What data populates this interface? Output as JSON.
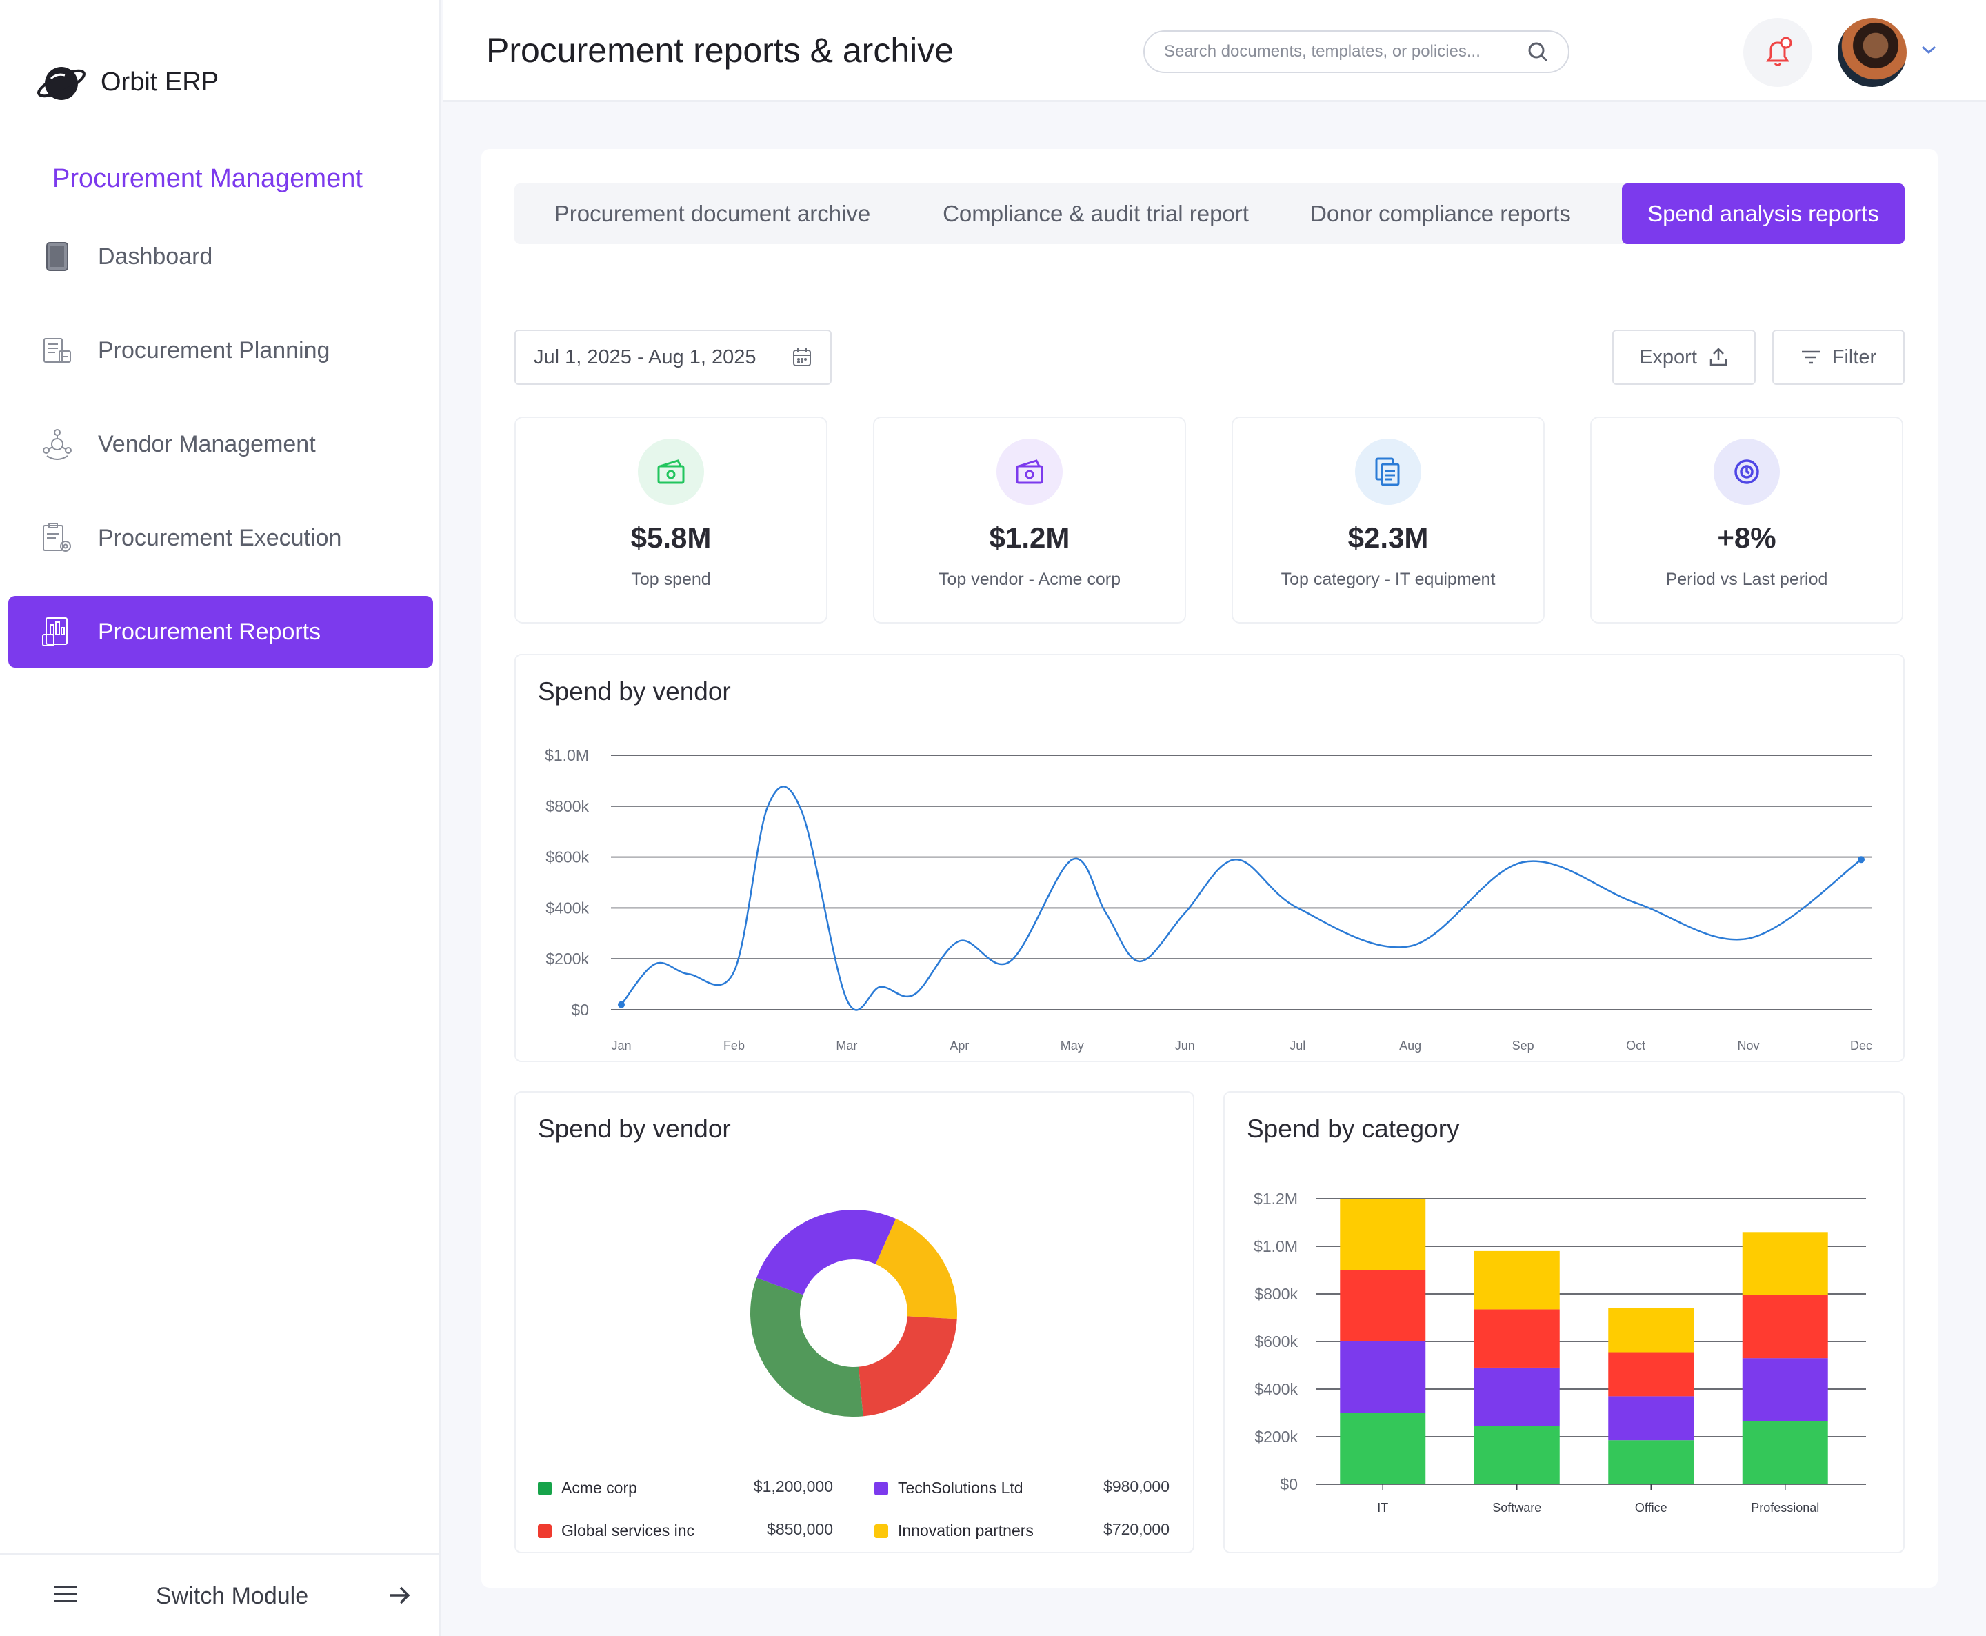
{
  "app": {
    "name": "Orbit ERP"
  },
  "sidebar": {
    "module_title": "Procurement Management",
    "items": [
      {
        "label": "Dashboard",
        "icon": "tablet-icon"
      },
      {
        "label": "Procurement Planning",
        "icon": "planning-clipboard-icon"
      },
      {
        "label": "Vendor Management",
        "icon": "vendor-network-icon"
      },
      {
        "label": "Procurement Execution",
        "icon": "execution-gear-icon"
      },
      {
        "label": "Procurement Reports",
        "icon": "report-chart-icon",
        "active": true
      }
    ],
    "footer": {
      "label": "Switch Module"
    }
  },
  "header": {
    "title": "Procurement reports & archive",
    "search_placeholder": "Search documents, templates, or policies..."
  },
  "tabs": [
    {
      "label": "Procurement document archive"
    },
    {
      "label": "Compliance & audit trial report"
    },
    {
      "label": "Donor compliance reports"
    },
    {
      "label": "Spend analysis reports",
      "active": true
    }
  ],
  "toolbar": {
    "date_range": "Jul 1, 2025 - Aug 1, 2025",
    "export_label": "Export",
    "filter_label": "Filter"
  },
  "stats": [
    {
      "value": "$5.8M",
      "label": "Top spend",
      "color": "#22c55e",
      "bg": "#e6f7ec",
      "icon": "money-icon"
    },
    {
      "value": "$1.2M",
      "label": "Top vendor - Acme corp",
      "color": "#7c3aed",
      "bg": "#f1eafd",
      "icon": "money-icon"
    },
    {
      "value": "$2.3M",
      "label": "Top category - IT equipment",
      "color": "#2b7bd6",
      "bg": "#e5f0fb",
      "icon": "documents-icon"
    },
    {
      "value": "+8%",
      "label": "Period vs Last period",
      "color": "#4f46e5",
      "bg": "#e8e8fb",
      "icon": "clock-icon"
    }
  ],
  "line_panel": {
    "title": "Spend by vendor"
  },
  "donut_panel": {
    "title": "Spend by vendor"
  },
  "bar_panel": {
    "title": "Spend by category"
  },
  "colors": {
    "accent": "#7c3aed",
    "line": "#2b7bd6"
  },
  "chart_data": [
    {
      "type": "line",
      "title": "Spend by vendor",
      "x": [
        "Jan",
        "Feb",
        "Mar",
        "Apr",
        "May",
        "Jun",
        "Jul",
        "Aug",
        "Sep",
        "Oct",
        "Nov",
        "Dec"
      ],
      "ytick_labels": [
        "$0",
        "$200k",
        "$400k",
        "$600k",
        "$800k",
        "$1.0M"
      ],
      "ylim": [
        0,
        1000000
      ],
      "grid": true,
      "points": [
        [
          "Jan",
          20000
        ],
        [
          "Jan",
          180000
        ],
        [
          "Jan",
          140000
        ],
        [
          "Feb",
          150000
        ],
        [
          "Feb",
          800000
        ],
        [
          "Feb",
          780000
        ],
        [
          "Mar",
          40000
        ],
        [
          "Mar",
          90000
        ],
        [
          "Mar",
          60000
        ],
        [
          "Apr",
          270000
        ],
        [
          "Apr",
          190000
        ],
        [
          "May",
          590000
        ],
        [
          "May",
          380000
        ],
        [
          "May",
          190000
        ],
        [
          "Jun",
          380000
        ],
        [
          "Jun",
          590000
        ],
        [
          "Jul",
          400000
        ],
        [
          "Aug",
          250000
        ],
        [
          "Sep",
          580000
        ],
        [
          "Oct",
          420000
        ],
        [
          "Nov",
          280000
        ],
        [
          "Dec",
          590000
        ]
      ]
    },
    {
      "type": "pie",
      "title": "Spend by vendor",
      "slices": [
        {
          "label": "Acme corp",
          "value": 1200000,
          "value_text": "$1,200,000",
          "color": "#52995a"
        },
        {
          "label": "TechSolutions Ltd",
          "value": 980000,
          "value_text": "$980,000",
          "color": "#7c3aed"
        },
        {
          "label": "Global services inc",
          "value": 850000,
          "value_text": "$850,000",
          "color": "#e8453c"
        },
        {
          "label": "Innovation partners",
          "value": 720000,
          "value_text": "$720,000",
          "color": "#fbbc0f"
        }
      ],
      "legend_swatches": {
        "Acme corp": "#16a34a",
        "TechSolutions Ltd": "#7c3aed",
        "Global services inc": "#ef3b2f",
        "Innovation partners": "#fdc70a"
      }
    },
    {
      "type": "bar",
      "stacked": true,
      "title": "Spend by category",
      "categories": [
        "IT",
        "Software",
        "Office",
        "Professional"
      ],
      "ytick_labels": [
        "$0",
        "$200k",
        "$400k",
        "$600k",
        "$800k",
        "$1.0M",
        "$1.2M"
      ],
      "ylim": [
        0,
        1200000
      ],
      "grid": true,
      "series": [
        {
          "color": "#34c759",
          "values": [
            300000,
            245000,
            185000,
            265000
          ]
        },
        {
          "color": "#7c3aed",
          "values": [
            300000,
            245000,
            185000,
            265000
          ]
        },
        {
          "color": "#ff3b30",
          "values": [
            300000,
            245000,
            185000,
            265000
          ]
        },
        {
          "color": "#ffcc00",
          "values": [
            300000,
            245000,
            185000,
            265000
          ]
        }
      ]
    }
  ]
}
